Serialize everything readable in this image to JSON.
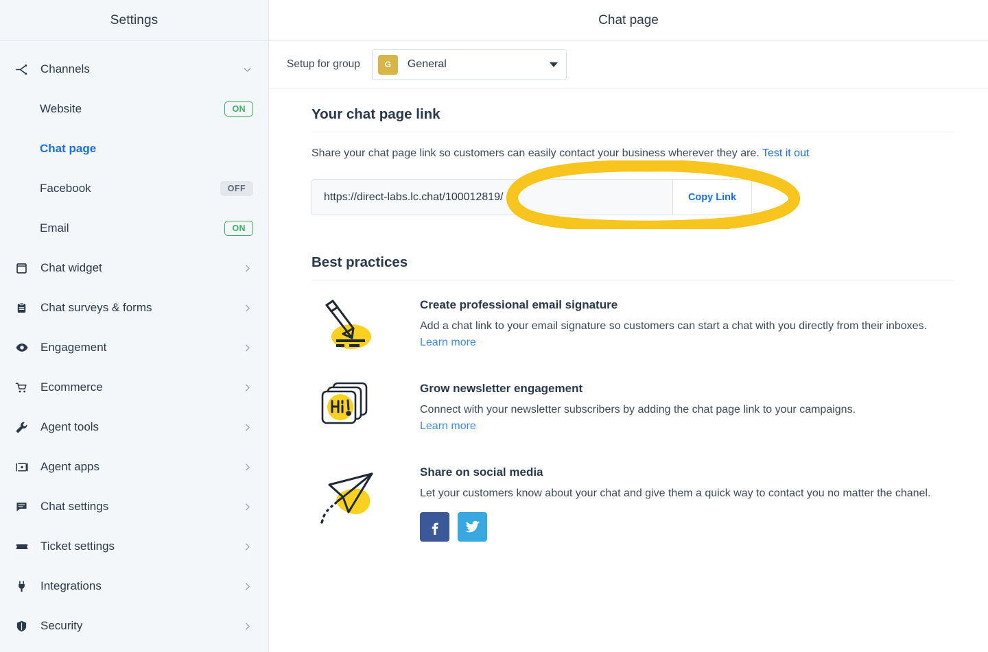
{
  "sidebar": {
    "title": "Settings",
    "group": {
      "label": "Channels",
      "icon": "share-branch-icon",
      "expanded_icon": "chevron-down-icon",
      "children": [
        {
          "label": "Website",
          "badge": "ON",
          "state": "on",
          "active": false
        },
        {
          "label": "Chat page",
          "badge": "",
          "state": "none",
          "active": true
        },
        {
          "label": "Facebook",
          "badge": "OFF",
          "state": "off",
          "active": false
        },
        {
          "label": "Email",
          "badge": "ON",
          "state": "on",
          "active": false
        }
      ]
    },
    "items": [
      {
        "label": "Chat widget",
        "icon": "square-widget-icon",
        "chevron": "chevron-right-icon"
      },
      {
        "label": "Chat surveys & forms",
        "icon": "clipboard-icon",
        "chevron": "chevron-right-icon"
      },
      {
        "label": "Engagement",
        "icon": "eye-icon",
        "chevron": "chevron-right-icon"
      },
      {
        "label": "Ecommerce",
        "icon": "shopping-cart-icon",
        "chevron": "chevron-right-icon"
      },
      {
        "label": "Agent tools",
        "icon": "wrench-icon",
        "chevron": "chevron-right-icon"
      },
      {
        "label": "Agent apps",
        "icon": "app-window-icon",
        "chevron": "chevron-right-icon"
      },
      {
        "label": "Chat settings",
        "icon": "chat-bubble-icon",
        "chevron": "chevron-right-icon"
      },
      {
        "label": "Ticket settings",
        "icon": "ticket-icon",
        "chevron": "chevron-right-icon"
      },
      {
        "label": "Integrations",
        "icon": "plug-icon",
        "chevron": "chevron-right-icon"
      },
      {
        "label": "Security",
        "icon": "shield-icon",
        "chevron": "chevron-right-icon"
      }
    ]
  },
  "header": {
    "title": "Chat page"
  },
  "subbar": {
    "label": "Setup for group",
    "group_initial": "G",
    "group_name": "General",
    "caret_icon": "caret-down-icon"
  },
  "link_section": {
    "title": "Your chat page link",
    "description": "Share your chat page link so customers can easily contact your business wherever they are.",
    "test_link": "Test it out",
    "url_value": "https://direct-labs.lc.chat/100012819/",
    "url_placeholder": "https://",
    "copy_label": "Copy Link"
  },
  "best_practices": {
    "title": "Best practices",
    "items": [
      {
        "art": "pencil-drawing-illustration",
        "heading": "Create professional email signature",
        "description": "Add a chat link to your email signature so customers can start a chat with you directly from their inboxes.",
        "link": "Learn more",
        "socials": []
      },
      {
        "art": "hi-cards-illustration",
        "heading": "Grow newsletter engagement",
        "description": "Connect with your newsletter subscribers by adding the chat page link to your campaigns.",
        "link": "Learn more",
        "socials": []
      },
      {
        "art": "paper-plane-illustration",
        "heading": "Share on social media",
        "description": "Let your customers know about your chat and give them a quick way to contact you no matter the chanel.",
        "link": "",
        "socials": [
          {
            "name": "facebook-share-button",
            "glyph": "f"
          },
          {
            "name": "twitter-share-button",
            "glyph": "t"
          }
        ]
      }
    ]
  },
  "annotation": {
    "type": "hand-drawn-ellipse-highlight",
    "color": "#f7c51e",
    "target": "url-input-field"
  },
  "colors": {
    "sidebar_bg": "#f3f7fa",
    "accent_blue": "#1a6ee8",
    "on_green": "#3fae63",
    "off_gray": "#5a6878",
    "group_avatar": "#d7b547",
    "highlight_yellow": "#f7c51e",
    "facebook_blue": "#3b5998",
    "twitter_blue": "#3aa8e0",
    "illustration_yellow": "#fbd01f",
    "illustration_ink": "#1f2933"
  }
}
